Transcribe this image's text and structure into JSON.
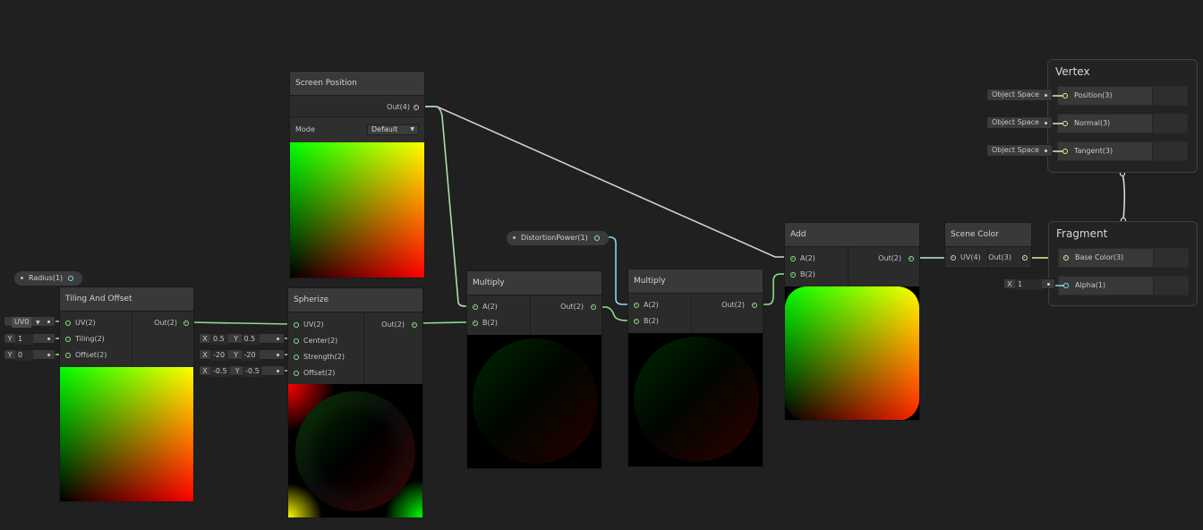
{
  "nodes": {
    "screen_position": {
      "title": "Screen Position",
      "out": "Out(4)",
      "mode_label": "Mode",
      "mode_value": "Default"
    },
    "tiling_offset": {
      "title": "Tiling And Offset",
      "in_uv": "UV(2)",
      "in_tiling": "Tiling(2)",
      "in_offset": "Offset(2)",
      "out": "Out(2)",
      "uv_value": "UV0",
      "tiling_y_label": "Y",
      "tiling_y": "1",
      "offset_y_label": "Y",
      "offset_y": "0"
    },
    "spherize": {
      "title": "Spherize",
      "in_uv": "UV(2)",
      "in_center": "Center(2)",
      "in_strength": "Strength(2)",
      "in_offset": "Offset(2)",
      "out": "Out(2)",
      "center": [
        "X",
        "0.5",
        "Y",
        "0.5"
      ],
      "strength": [
        "X",
        "-20",
        "Y",
        "-20"
      ],
      "offset": [
        "X",
        "-0.5",
        "Y",
        "-0.5"
      ]
    },
    "multiply1": {
      "title": "Multiply",
      "in_a": "A(2)",
      "in_b": "B(2)",
      "out": "Out(2)"
    },
    "multiply2": {
      "title": "Multiply",
      "in_a": "A(2)",
      "in_b": "B(2)",
      "out": "Out(2)"
    },
    "add": {
      "title": "Add",
      "in_a": "A(2)",
      "in_b": "B(2)",
      "out": "Out(2)"
    },
    "scene_color": {
      "title": "Scene Color",
      "in_uv": "UV(4)",
      "out": "Out(3)"
    }
  },
  "properties": {
    "radius": "Radius(1)",
    "distortion": "DistortionPower(1)"
  },
  "vertex": {
    "title": "Vertex",
    "slots": [
      {
        "space": "Object Space",
        "label": "Position(3)"
      },
      {
        "space": "Object Space",
        "label": "Normal(3)"
      },
      {
        "space": "Object Space",
        "label": "Tangent(3)"
      }
    ]
  },
  "fragment": {
    "title": "Fragment",
    "base_color": "Base Color(3)",
    "alpha": "Alpha(1)",
    "alpha_x_label": "X",
    "alpha_value": "1"
  },
  "colors": {
    "background": "#202020",
    "wire_green": "#8ae08a",
    "wire_pink": "#e8b5e8",
    "wire_blue": "#8ad8ec",
    "wire_yellow": "#e8e89a"
  }
}
